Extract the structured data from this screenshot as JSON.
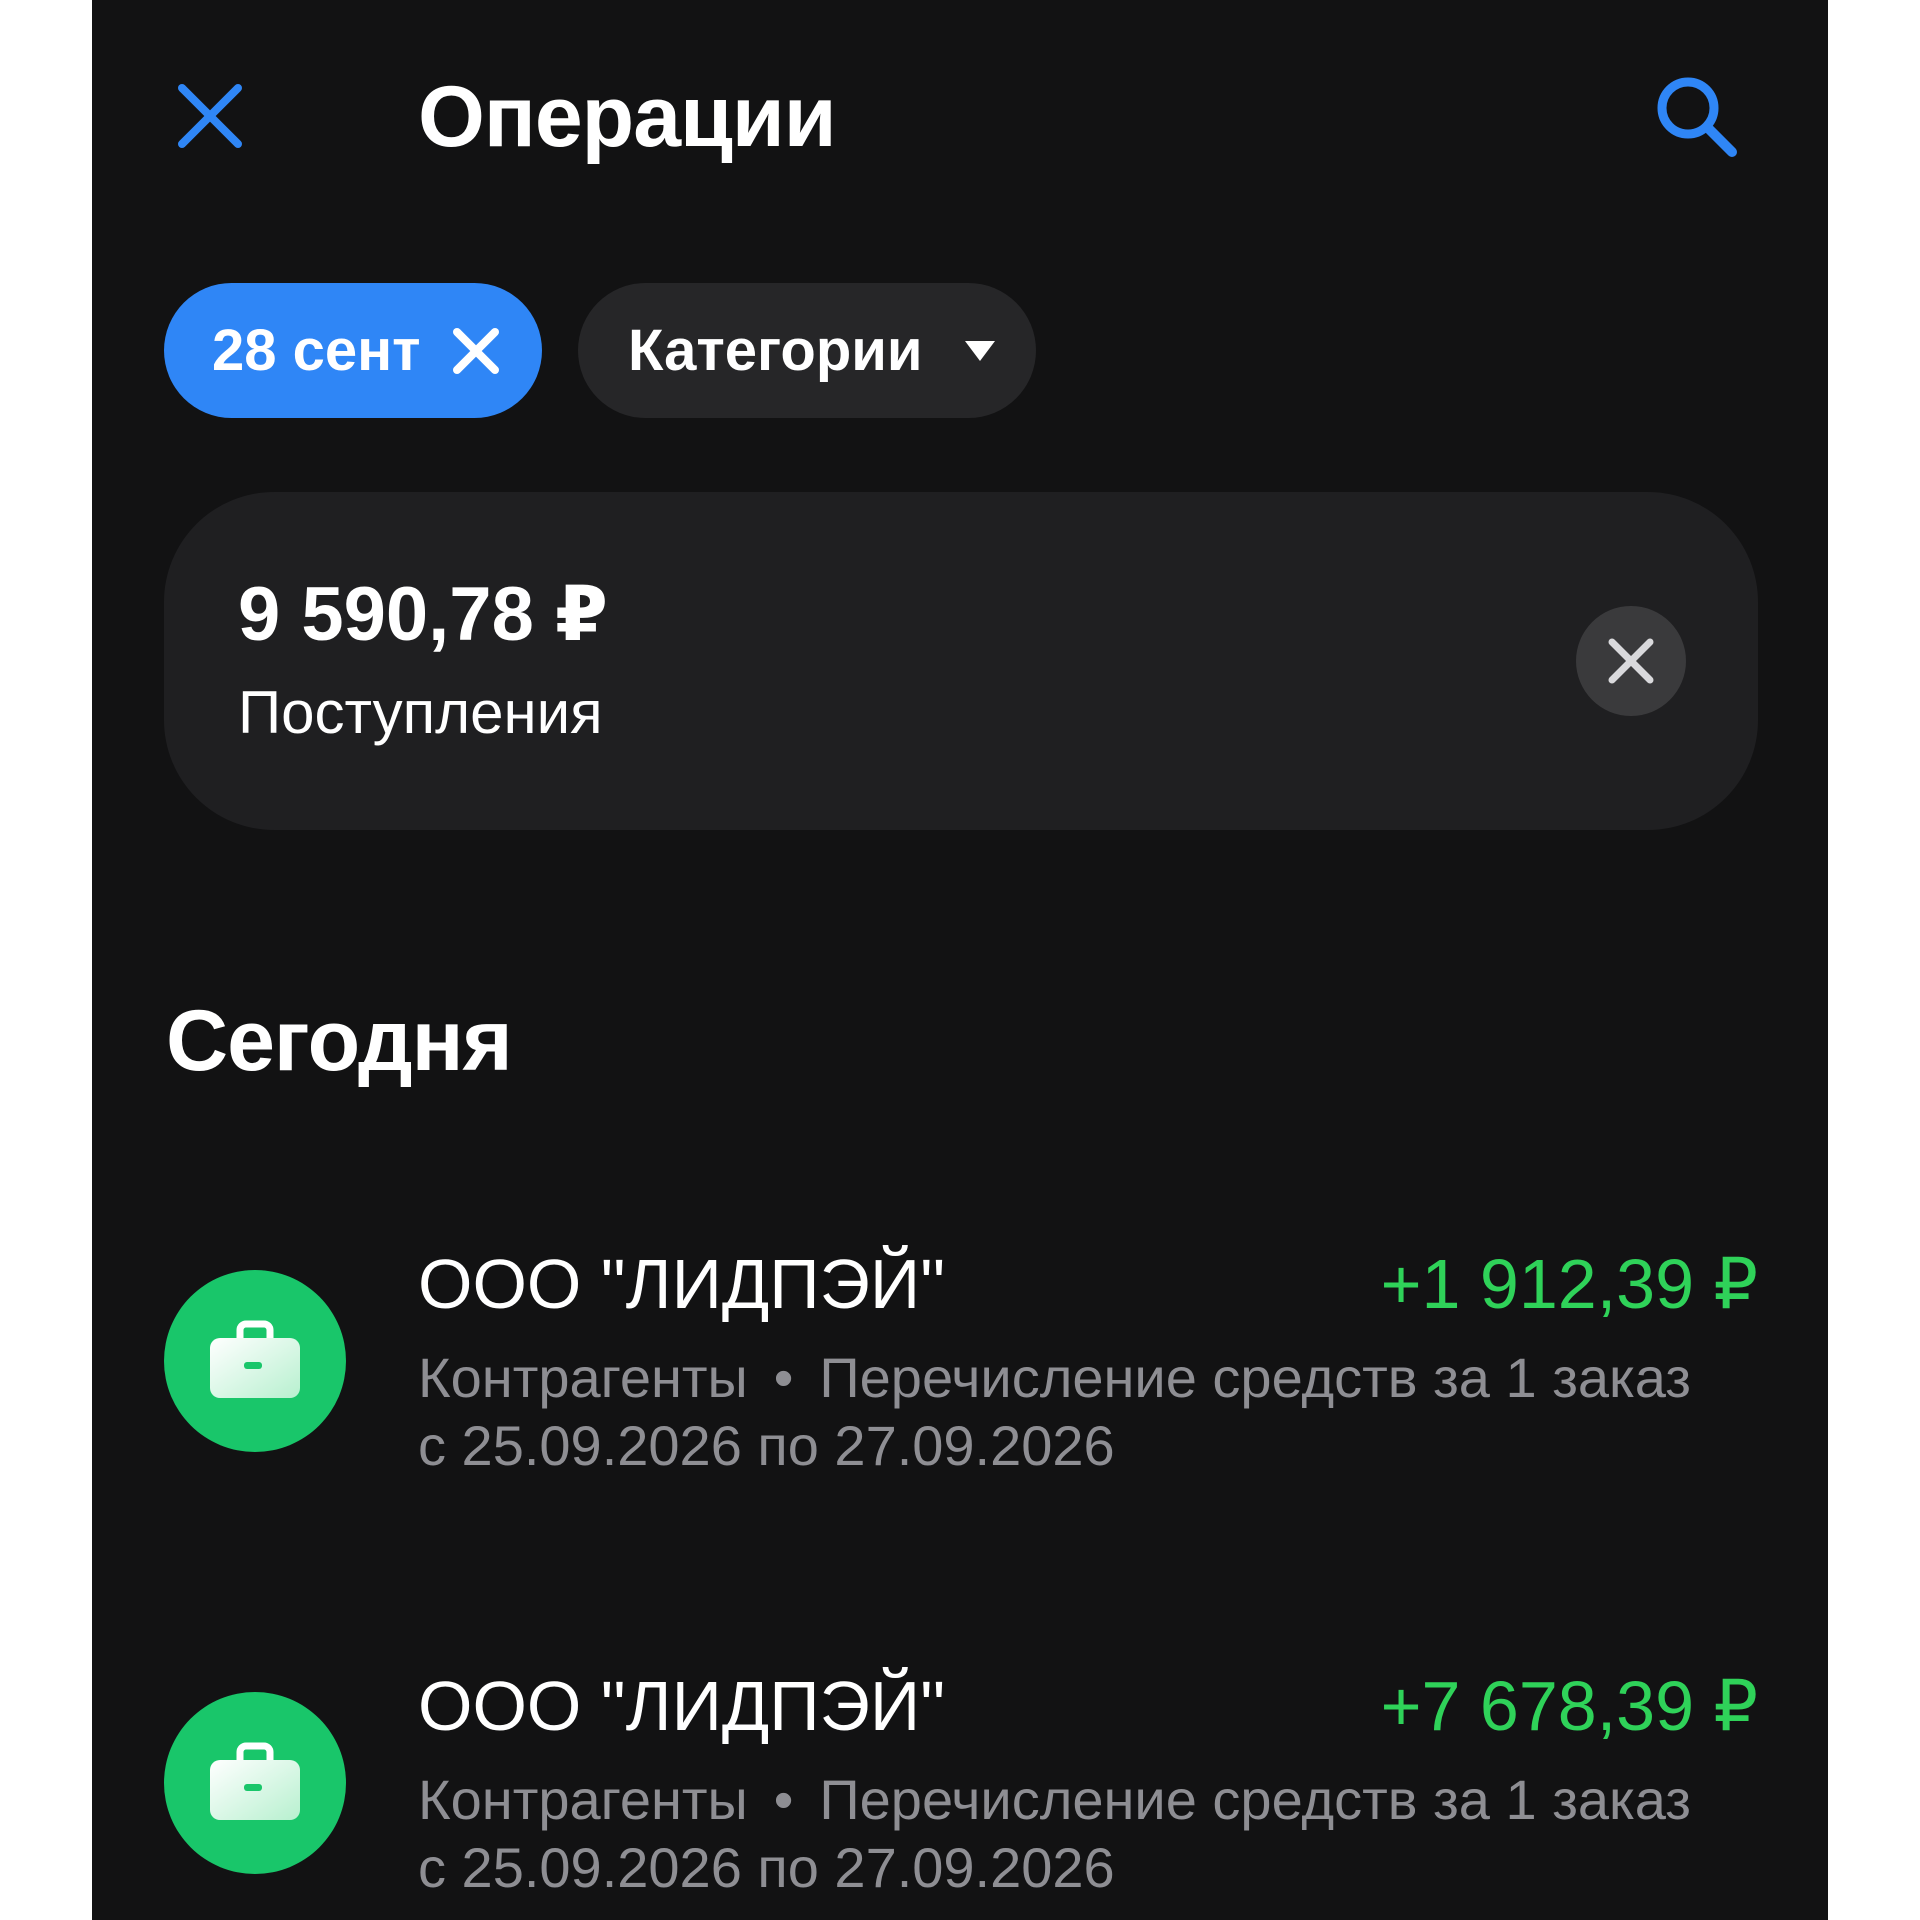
{
  "header": {
    "title": "Операции",
    "close_icon": "close-icon",
    "search_icon": "search-icon"
  },
  "filters": {
    "date_chip": "28 сент",
    "category_chip": "Категории"
  },
  "summary": {
    "amount": "9 590,78 ₽",
    "label": "Поступления"
  },
  "section": {
    "title": "Сегодня"
  },
  "transactions": [
    {
      "name": "ООО \"ЛИДПЭЙ\"",
      "amount": "+1 912,39 ₽",
      "category": "Контрагенты",
      "separator": "•",
      "description": "Перечисление средств за 1 заказ с 25.09.2026 по 27.09.2026",
      "icon": "briefcase-icon"
    },
    {
      "name": "ООО \"ЛИДПЭЙ\"",
      "amount": "+7 678,39 ₽",
      "category": "Контрагенты",
      "separator": "•",
      "description": "Перечисление средств за 1 заказ с 25.09.2026 по 27.09.2026",
      "icon": "briefcase-icon"
    }
  ],
  "colors": {
    "background": "#121213",
    "accent": "#2f86f6",
    "income": "#2fd259",
    "avatar": "#19c66a",
    "card": "#1f1f21",
    "chip": "#262628",
    "muted_text": "#8e8e93"
  }
}
